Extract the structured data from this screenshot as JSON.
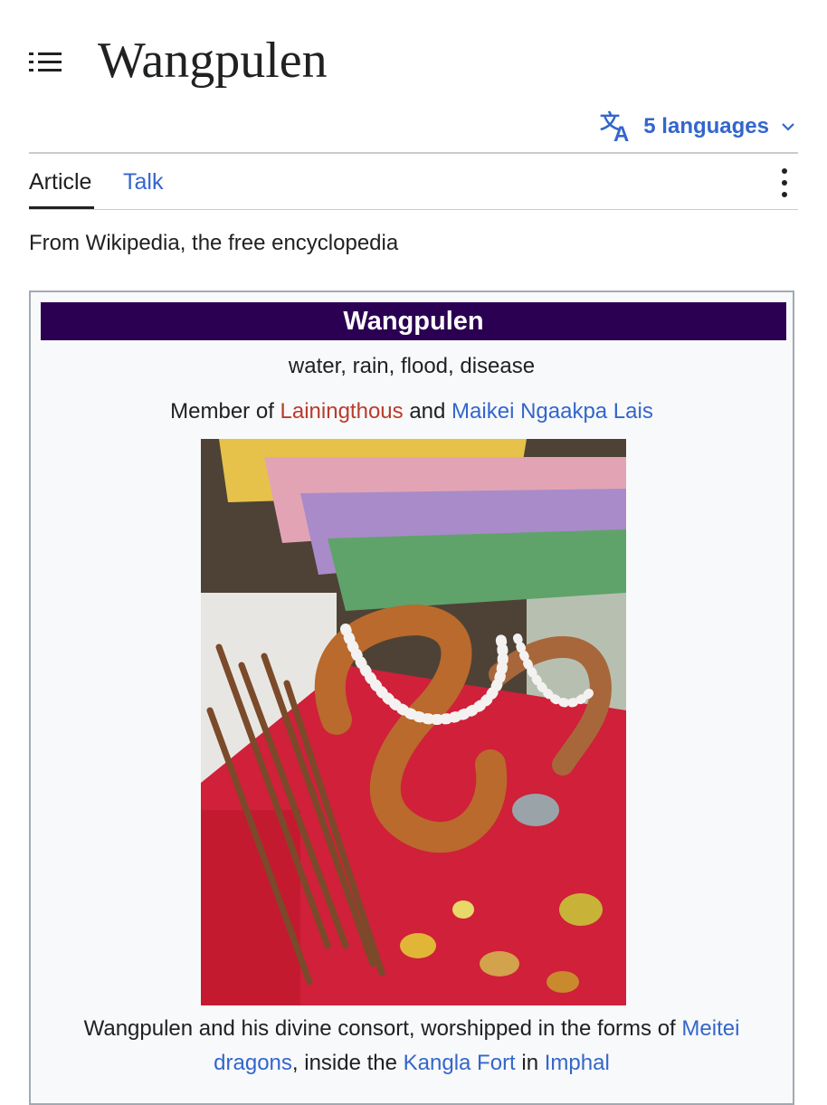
{
  "page": {
    "title": "Wangpulen",
    "languages_label": "5 languages",
    "tagline": "From Wikipedia, the free encyclopedia"
  },
  "tabs": {
    "article": "Article",
    "talk": "Talk"
  },
  "icons": {
    "menu": "menu-icon",
    "language": "translate-icon",
    "dropdown": "chevron-down-icon",
    "more": "more-vertical-icon"
  },
  "infobox": {
    "title": "Wangpulen",
    "domains": "water, rain, flood, disease",
    "member_prefix": "Member of",
    "member_link_1": "Lainingthous",
    "member_and": "and",
    "member_link_2": "Maikei Ngaakpa Lais",
    "caption_text_1": "Wangpulen and his divine consort, worshipped in the forms of",
    "caption_link_1": "Meitei dragons",
    "caption_text_2": ", inside the",
    "caption_link_2": "Kangla Fort",
    "caption_text_3": "in",
    "caption_link_3": "Imphal"
  },
  "colors": {
    "link": "#3366cc",
    "redlink": "#ba3b2b",
    "infobox_header": "#2b0052",
    "infobox_bg": "#f8f9fa",
    "border": "#a2a9b1"
  }
}
